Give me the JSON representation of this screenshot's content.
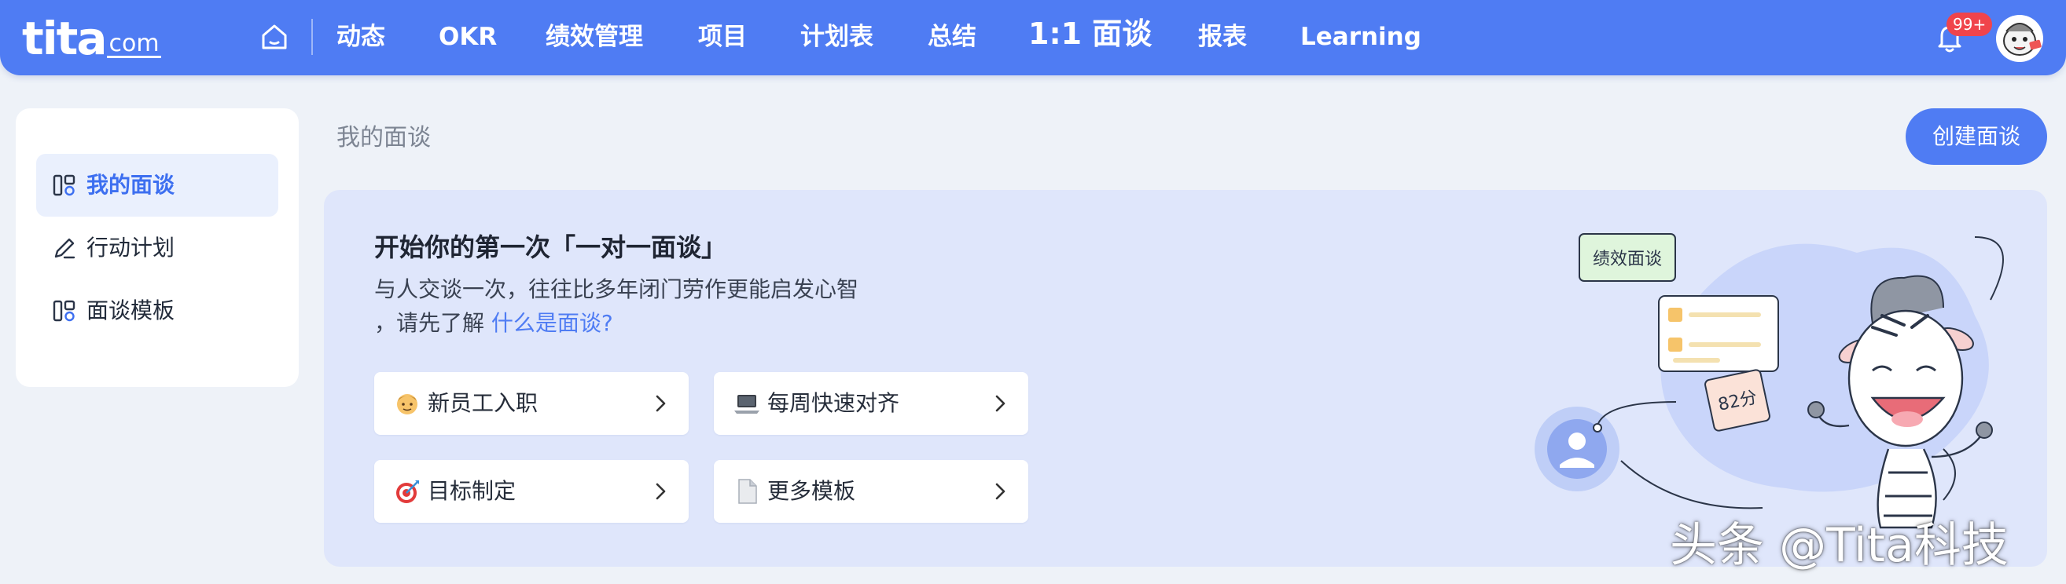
{
  "brand": {
    "logo_main": "tita",
    "logo_sub": "com"
  },
  "nav": {
    "items": [
      "动态",
      "OKR",
      "绩效管理",
      "项目",
      "计划表",
      "总结",
      "1:1 面谈",
      "报表",
      "Learning"
    ],
    "active_index": 6
  },
  "notifications": {
    "badge": "99+"
  },
  "sidebar": {
    "items": [
      {
        "label": "我的面谈",
        "icon": "meeting-icon",
        "active": true
      },
      {
        "label": "行动计划",
        "icon": "pencil-icon",
        "active": false
      },
      {
        "label": "面谈模板",
        "icon": "template-icon",
        "active": false
      }
    ]
  },
  "main": {
    "page_title": "我的面谈",
    "create_button": "创建面谈",
    "banner": {
      "title": "开始你的第一次「一对一面谈」",
      "desc_line1": "与人交谈一次，往往比多年闭门劳作更能启发心智",
      "desc_line2_prefix": "，请先了解",
      "desc_link": "什么是面谈?"
    },
    "templates": [
      {
        "label": "新员工入职",
        "icon": "person-emoji-icon"
      },
      {
        "label": "每周快速对齐",
        "icon": "laptop-emoji-icon"
      },
      {
        "label": "目标制定",
        "icon": "target-emoji-icon"
      },
      {
        "label": "更多模板",
        "icon": "document-emoji-icon"
      }
    ],
    "illustration": {
      "tag": "绩效面谈",
      "score": "82分"
    }
  },
  "watermark": "头条 @Tita科技",
  "colors": {
    "primary": "#4f7cf3",
    "badge": "#f0444b",
    "banner_bg": "#dfe6fb",
    "page_bg": "#eef2f8"
  }
}
